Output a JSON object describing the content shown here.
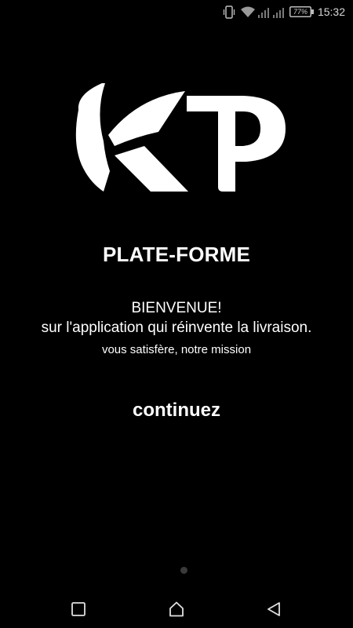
{
  "status_bar": {
    "icons": [
      "vibrate-icon",
      "wifi-icon",
      "signal-icon",
      "signal-icon",
      "battery-icon"
    ],
    "battery_percent": "77%",
    "time": "15:32"
  },
  "logo": {
    "text": "KP",
    "color": "#ffffff"
  },
  "main": {
    "title": "PLATE-FORME",
    "welcome_line1": "BIENVENUE!",
    "welcome_line2": "sur l'application qui réinvente la livraison.",
    "tagline": "vous satisfère, notre mission",
    "continue_label": "continuez"
  },
  "pager": {
    "current_page": 1,
    "total_pages": 1
  },
  "nav_bar": {
    "buttons": [
      "recent-apps",
      "home",
      "back"
    ]
  },
  "colors": {
    "background": "#000000",
    "text": "#ffffff",
    "status_text": "#d8d8d8",
    "dot": "#3a3a3a"
  }
}
